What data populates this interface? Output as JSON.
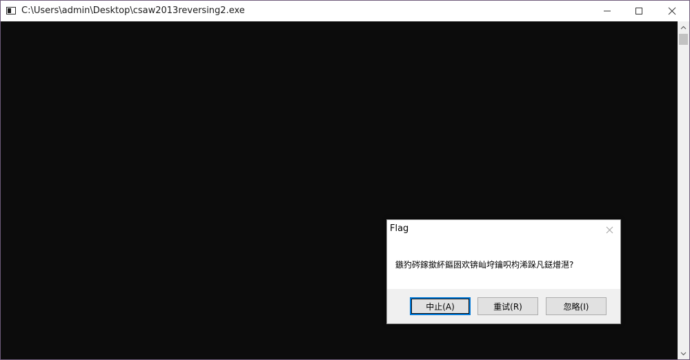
{
  "window": {
    "title": "C:\\Users\\admin\\Desktop\\csaw2013reversing2.exe",
    "app_icon": "console-window-icon",
    "controls": {
      "minimize": "minimize-icon",
      "maximize": "maximize-icon",
      "close": "close-icon"
    }
  },
  "console": {
    "background": "#0c0c0c"
  },
  "dialog": {
    "title": "Flag",
    "message": "鏃犳硶鎵撳紑鏂囦欢锛屾垨鑰呮枃浠跺凡鎹熷潖?",
    "buttons": {
      "abort": "中止(A)",
      "retry": "重试(R)",
      "ignore": "忽略(I)"
    },
    "default_button": "abort",
    "accent_color": "#0078d7"
  }
}
